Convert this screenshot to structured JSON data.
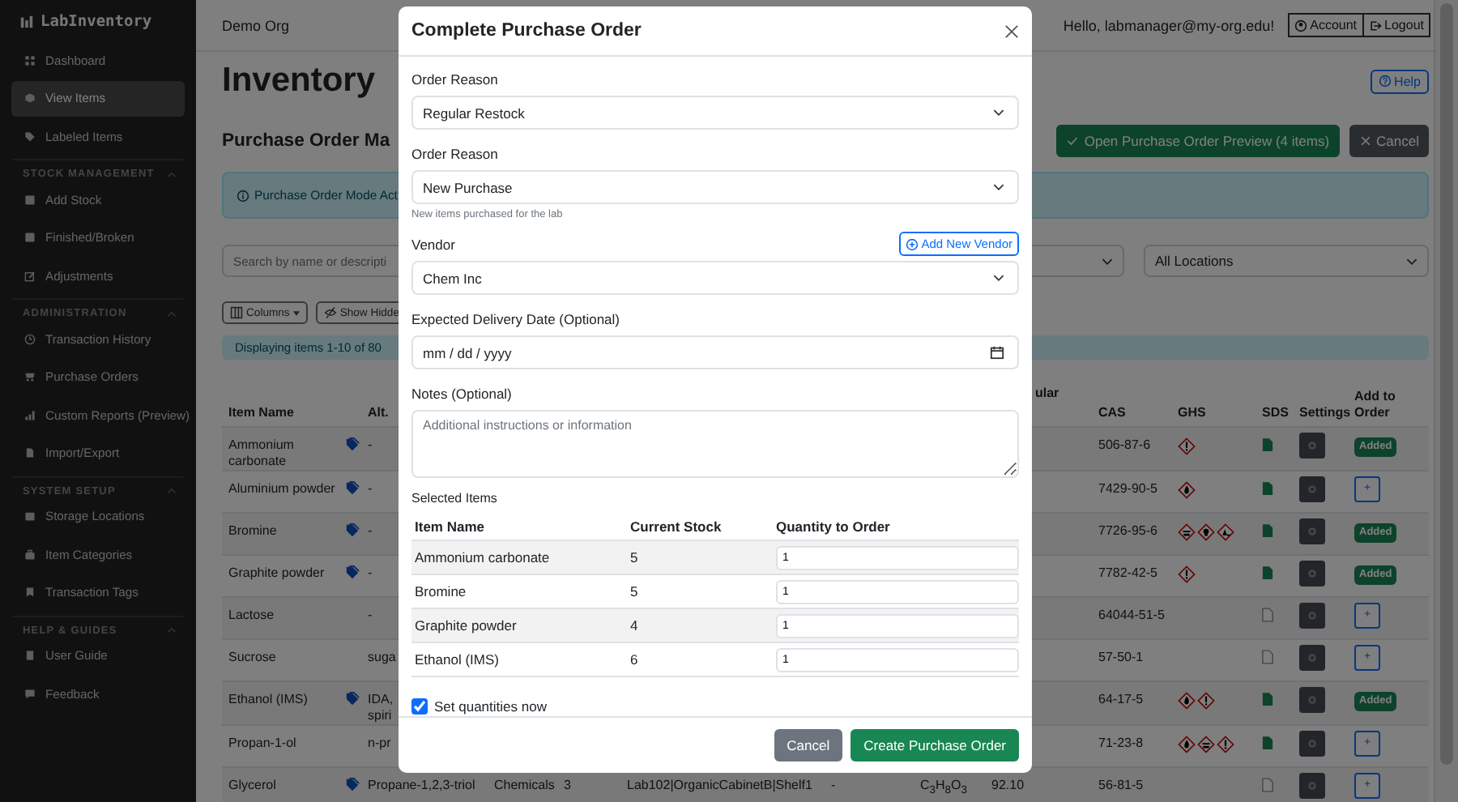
{
  "sidebar": {
    "brand": "LabInventory",
    "sections": [
      {
        "items": [
          {
            "label": "Dashboard",
            "selected": false
          },
          {
            "label": "View Items",
            "selected": true
          },
          {
            "label": "Labeled Items",
            "selected": false
          }
        ]
      },
      {
        "title": "STOCK MANAGEMENT",
        "items": [
          {
            "label": "Add Stock",
            "selected": false
          },
          {
            "label": "Finished/Broken",
            "selected": false
          },
          {
            "label": "Adjustments",
            "selected": false
          }
        ]
      },
      {
        "title": "ADMINISTRATION",
        "items": [
          {
            "label": "Transaction History",
            "selected": false
          },
          {
            "label": "Purchase Orders",
            "selected": false
          },
          {
            "label": "Custom Reports (Preview)",
            "selected": false
          },
          {
            "label": "Import/Export",
            "selected": false
          }
        ]
      },
      {
        "title": "SYSTEM SETUP",
        "items": [
          {
            "label": "Storage Locations",
            "selected": false
          },
          {
            "label": "Item Categories",
            "selected": false
          },
          {
            "label": "Transaction Tags",
            "selected": false
          }
        ]
      },
      {
        "title": "HELP & GUIDES",
        "items": [
          {
            "label": "User Guide",
            "selected": false
          },
          {
            "label": "Feedback",
            "selected": false
          }
        ]
      }
    ]
  },
  "topbar": {
    "org": "Demo Org",
    "greeting": "Hello, labmanager@my-org.edu!",
    "buttons": [
      "Account",
      "Logout"
    ]
  },
  "page": {
    "title": "Inventory",
    "help": "Help",
    "subtitle": "Purchase Order Ma",
    "preview_button": "Open Purchase Order Preview (4 items)",
    "cancel_button": "Cancel",
    "alert": "Purchase Order Mode Act",
    "search_placeholder": "Search by name or descripti",
    "location_filter": "All Locations",
    "columns_button": "Columns",
    "hidden_button": "Show Hidde",
    "display_info": "Displaying items 1-10 of 80"
  },
  "table": {
    "header": {
      "item_name": "Item Name",
      "alt": "Alt.",
      "column_9": "ular",
      "cas": "CAS",
      "ghs": "GHS",
      "sds": "SDS",
      "settings": "Settings",
      "add_to_order": "Add to Order"
    },
    "rows": [
      {
        "name": "Ammonium carbonate",
        "tagged": true,
        "alt": "-",
        "cas": "506-87-6",
        "ghs": [
          {
            "kind": "exclamation"
          }
        ],
        "sds": true,
        "order": {
          "added": true,
          "label": "Added"
        }
      },
      {
        "name": "Aluminium powder",
        "tagged": true,
        "alt": "-",
        "cas": "7429-90-5",
        "ghs": [
          {
            "kind": "flame"
          }
        ],
        "sds": true,
        "order": {
          "added": false,
          "label": "+"
        }
      },
      {
        "name": "Bromine",
        "tagged": true,
        "alt": "-",
        "cas": "7726-95-6",
        "ghs": [
          {
            "kind": "corrosive"
          },
          {
            "kind": "toxic"
          },
          {
            "kind": "environment"
          }
        ],
        "sds": true,
        "order": {
          "added": true,
          "label": "Added"
        }
      },
      {
        "name": "Graphite powder",
        "tagged": true,
        "alt": "-",
        "cas": "7782-42-5",
        "ghs": [
          {
            "kind": "exclamation"
          }
        ],
        "sds": true,
        "order": {
          "added": true,
          "label": "Added"
        }
      },
      {
        "name": "Lactose",
        "tagged": false,
        "alt": "-",
        "cas": "64044-51-5",
        "ghs": [],
        "sds": false,
        "order": {
          "added": false,
          "label": "+"
        }
      },
      {
        "name": "Sucrose",
        "tagged": false,
        "alt": "suga",
        "cas": "57-50-1",
        "ghs": [],
        "sds": false,
        "order": {
          "added": false,
          "label": "+"
        }
      },
      {
        "name": "Ethanol (IMS)",
        "tagged": true,
        "alt": "IDA,\nspiri",
        "cas": "64-17-5",
        "ghs": [
          {
            "kind": "flame"
          },
          {
            "kind": "exclamation"
          }
        ],
        "sds": true,
        "order": {
          "added": true,
          "label": "Added"
        }
      },
      {
        "name": "Propan-1-ol",
        "tagged": false,
        "alt": "n-pr",
        "cas": "71-23-8",
        "ghs": [
          {
            "kind": "flame"
          },
          {
            "kind": "corrosive"
          },
          {
            "kind": "exclamation"
          }
        ],
        "sds": true,
        "order": {
          "added": false,
          "label": "+"
        }
      },
      {
        "name": "Glycerol",
        "tagged": true,
        "alt": "Propane-1,2,3-triol",
        "category": "Chemicals",
        "quantity": "3",
        "location": "Lab102|OrganicCabinetB|Shelf1",
        "column_7": "-",
        "formula": "C$_{3}$H$_{8}$O$_{3}$",
        "column_9": "92.10",
        "cas": "56-81-5",
        "ghs": [],
        "sds": false,
        "order": {
          "added": false,
          "label": "+"
        }
      }
    ]
  },
  "modal": {
    "title": "Complete Purchase Order",
    "fields": [
      {
        "kind": "select",
        "label": "Order Reason",
        "value": "Regular Restock"
      },
      {
        "kind": "select",
        "label": "Order Reason",
        "value": "New Purchase",
        "help": "New items purchased for the lab"
      },
      {
        "kind": "select",
        "label": "Vendor",
        "value": "Chem Inc",
        "action": "Add New Vendor"
      },
      {
        "kind": "date",
        "label": "Expected Delivery Date (Optional)",
        "placeholder": "mm / dd / yyyy"
      },
      {
        "kind": "textarea",
        "label": "Notes (Optional)",
        "placeholder": "Additional instructions or information"
      }
    ],
    "items_label": "Selected Items",
    "items_columns": [
      "Item Name",
      "Current Stock",
      "Quantity to Order"
    ],
    "items": [
      {
        "name": "Ammonium carbonate",
        "stock": "5",
        "quantity": "1"
      },
      {
        "name": "Bromine",
        "stock": "5",
        "quantity": "1"
      },
      {
        "name": "Graphite powder",
        "stock": "4",
        "quantity": "1"
      },
      {
        "name": "Ethanol (IMS)",
        "stock": "6",
        "quantity": "1"
      }
    ],
    "set_quantities": {
      "label": "Set quantities now",
      "checked": true
    },
    "buttons": [
      {
        "kind": "secondary",
        "label": "Cancel"
      },
      {
        "kind": "primary",
        "label": "Create Purchase Order"
      }
    ]
  }
}
